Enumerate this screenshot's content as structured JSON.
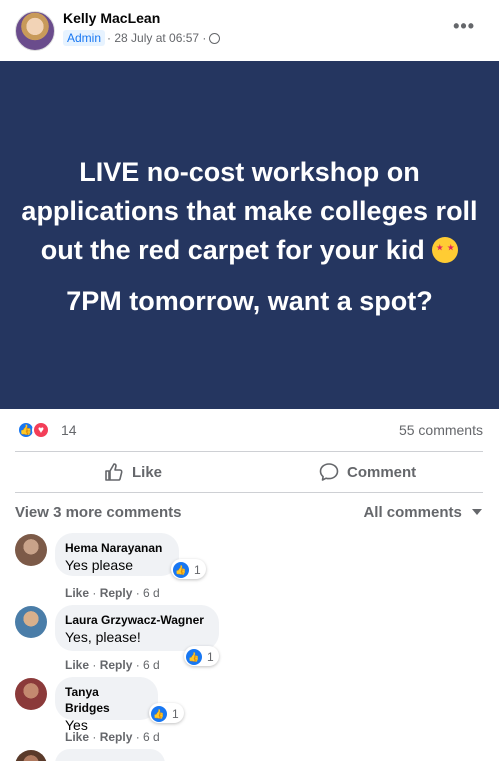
{
  "post": {
    "author": "Kelly MacLean",
    "badge": "Admin",
    "timestamp": "· 28 July at 06:57 ·",
    "privacy_icon": "globe-icon",
    "more_icon": "•••"
  },
  "banner": {
    "line1": "LIVE no-cost workshop on applications that make colleges roll out the red carpet for your kid",
    "emoji": "star-struck-emoji",
    "line2": "7PM tomorrow, want a spot?",
    "bg_color": "#253660"
  },
  "stats": {
    "reaction_count": "14",
    "comment_count": "55 comments"
  },
  "actions": {
    "like": "Like",
    "comment": "Comment"
  },
  "comments_header": {
    "view_more": "View 3 more comments",
    "filter": "All comments"
  },
  "comments": [
    {
      "name": "Hema Narayanan",
      "text": "Yes please",
      "reactions": "1",
      "like": "Like",
      "reply": "Reply",
      "age": "6 d"
    },
    {
      "name": "Laura Grzywacz-Wagner",
      "text": "Yes, please!",
      "reactions": "1",
      "like": "Like",
      "reply": "Reply",
      "age": "6 d"
    },
    {
      "name": "Tanya Bridges",
      "text": "Yes",
      "reactions": "1",
      "like": "Like",
      "reply": "Reply",
      "age": "6 d"
    }
  ],
  "colors": {
    "accent": "#1877f2",
    "love": "#f33e58",
    "secondary_text": "#65676b"
  }
}
